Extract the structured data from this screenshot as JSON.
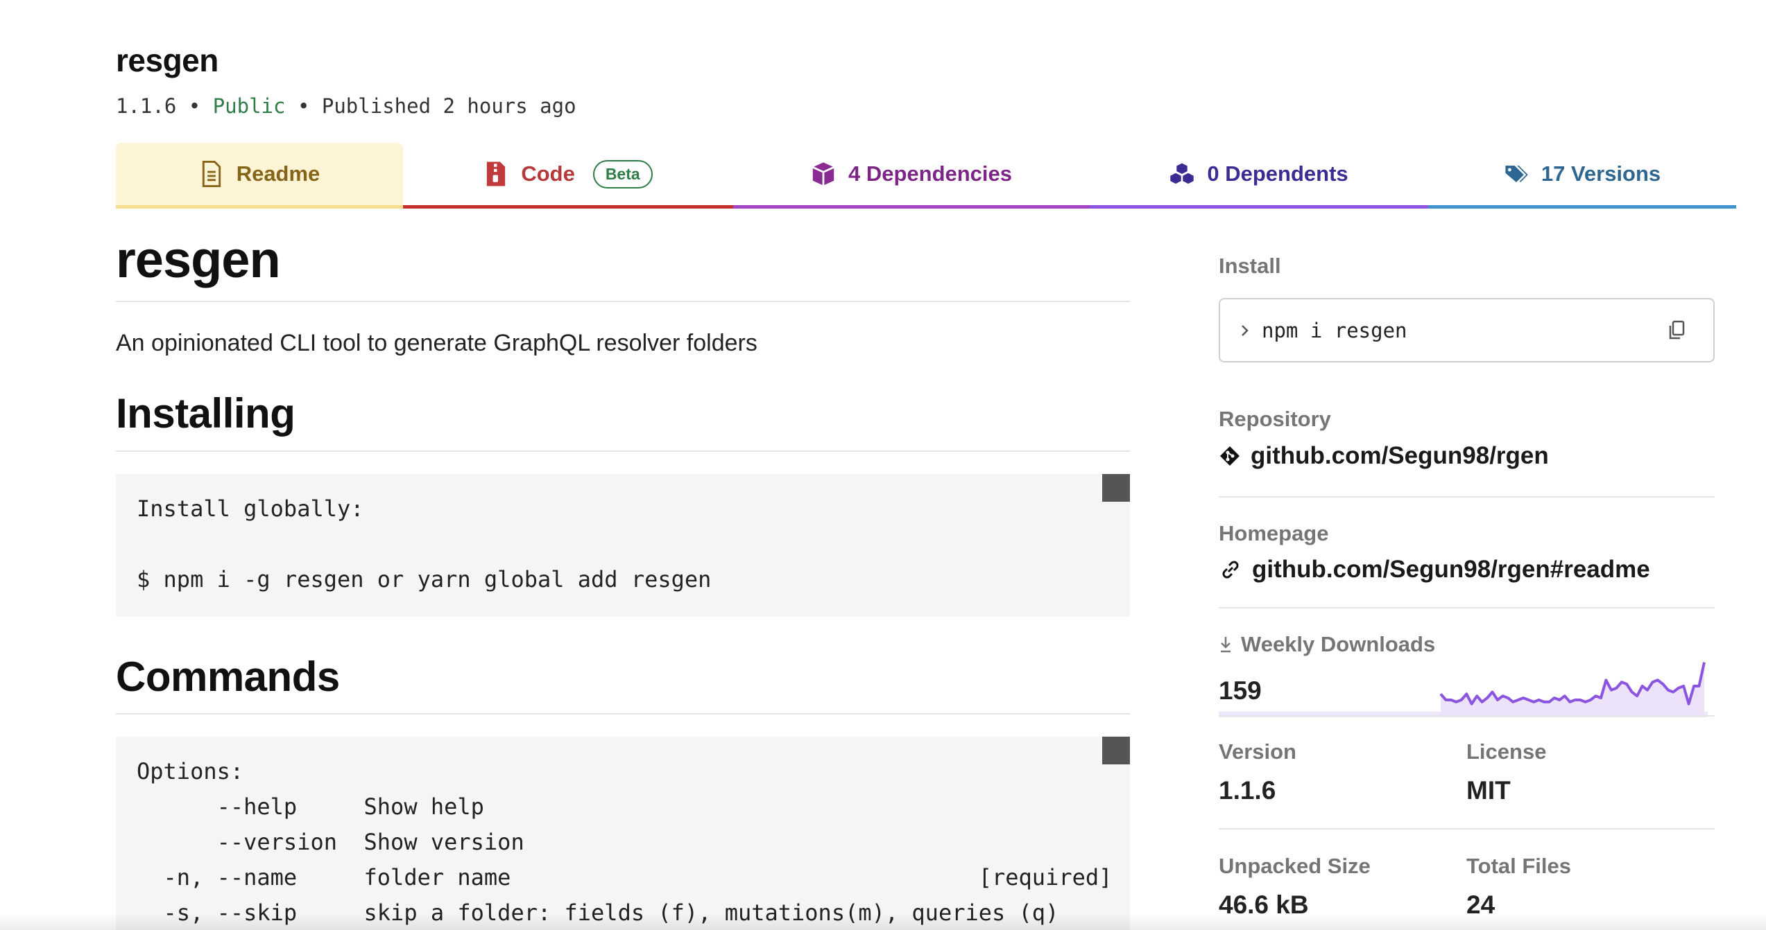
{
  "package": {
    "name": "resgen",
    "version": "1.1.6",
    "separator": "•",
    "visibility": "Public",
    "published": "Published 2 hours ago"
  },
  "tabs": {
    "readme": "Readme",
    "code": "Code",
    "code_badge": "Beta",
    "dependencies": "4 Dependencies",
    "dependents": "0 Dependents",
    "versions": "17 Versions"
  },
  "readme": {
    "title": "resgen",
    "description": "An opinionated CLI tool to generate GraphQL resolver folders",
    "installing_heading": "Installing",
    "install_code": "Install globally:\n\n$ npm i -g resgen or yarn global add resgen",
    "commands_heading": "Commands",
    "commands_code": "Options:\n      --help     Show help\n      --version  Show version\n  -n, --name     folder name                                   [required]\n  -s, --skip     skip a folder: fields (f), mutations(m), queries (q)"
  },
  "sidebar": {
    "install_label": "Install",
    "install_command": "npm i resgen",
    "repository_label": "Repository",
    "repository_link": "github.com/Segun98/rgen",
    "homepage_label": "Homepage",
    "homepage_link": "github.com/Segun98/rgen#readme",
    "weekly_downloads_label": "Weekly Downloads",
    "weekly_downloads": "159",
    "version_label": "Version",
    "version_value": "1.1.6",
    "license_label": "License",
    "license_value": "MIT",
    "unpacked_size_label": "Unpacked Size",
    "unpacked_size_value": "46.6 kB",
    "total_files_label": "Total Files",
    "total_files_value": "24"
  },
  "colors": {
    "public": "#2e7d47",
    "readme_tab": "#86651a",
    "code_tab": "#b5383a",
    "dependencies_tab": "#7d2587",
    "dependents_tab": "#3a2c92",
    "versions_tab": "#2d6690",
    "sparkline": "#8b55e0"
  },
  "chart_data": {
    "type": "area",
    "series": [
      {
        "values": [
          10,
          7,
          7,
          6,
          7,
          10,
          5,
          9,
          6,
          8,
          11,
          7,
          9,
          8,
          6,
          7,
          8,
          7,
          6,
          7,
          6,
          6,
          8,
          7,
          9,
          6,
          7,
          7,
          6,
          7,
          9,
          8,
          17,
          12,
          13,
          16,
          15,
          11,
          9,
          14,
          12,
          16,
          17,
          15,
          12,
          11,
          13,
          14,
          5,
          14,
          14,
          26
        ]
      }
    ],
    "ylim": [
      0,
      28
    ]
  }
}
